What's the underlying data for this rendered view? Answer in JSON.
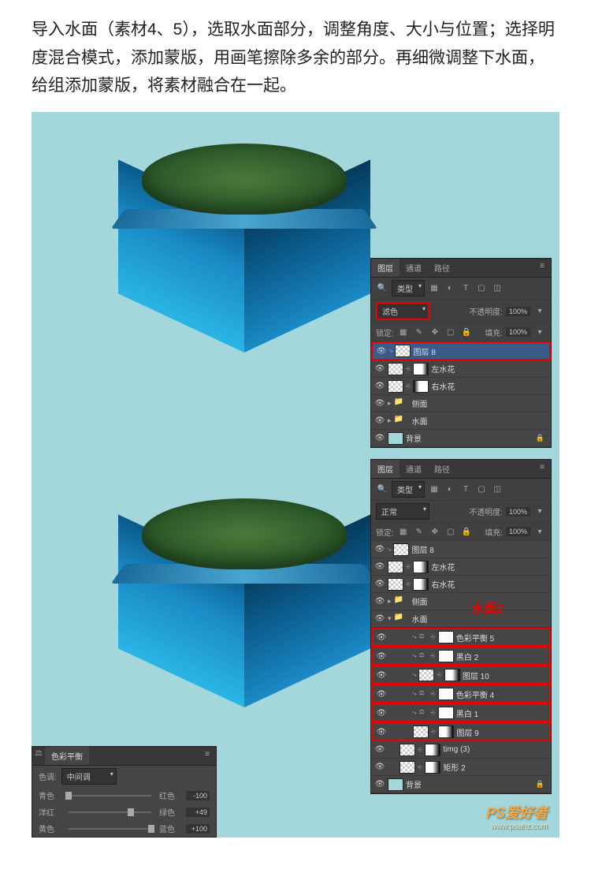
{
  "instructions": "导入水面（素材4、5），选取水面部分，调整角度、大小与位置；选择明度混合模式，添加蒙版，用画笔擦除多余的部分。再细微调整下水面，给组添加蒙版，将素材融合在一起。",
  "panel1": {
    "tabs": [
      "图层",
      "通道",
      "路径"
    ],
    "kind_label": "类型",
    "blend_mode": "滤色",
    "opacity_label": "不透明度:",
    "opacity_value": "100%",
    "lock_label": "锁定:",
    "fill_label": "填充:",
    "fill_value": "100%",
    "layers": [
      {
        "name": "图层 8",
        "selected": true,
        "clip": true
      },
      {
        "name": "左水花"
      },
      {
        "name": "右水花"
      },
      {
        "name": "侧面",
        "folder": true
      },
      {
        "name": "水面",
        "folder": true
      },
      {
        "name": "背景",
        "bg": true,
        "locked": true
      }
    ]
  },
  "panel2": {
    "tabs": [
      "图层",
      "通道",
      "路径"
    ],
    "kind_label": "类型",
    "blend_mode": "正常",
    "opacity_label": "不透明度:",
    "opacity_value": "100%",
    "lock_label": "锁定:",
    "fill_label": "填充:",
    "fill_value": "100%",
    "annotation": "水面2",
    "layers": [
      {
        "name": "图层 8",
        "clip": true
      },
      {
        "name": "左水花"
      },
      {
        "name": "右水花"
      },
      {
        "name": "侧面",
        "folder": true
      },
      {
        "name": "水面",
        "folder": true,
        "open": true
      },
      {
        "name": "色彩平衡 5",
        "indent": 2,
        "adj": true,
        "clip": true,
        "red": true
      },
      {
        "name": "黑白 2",
        "indent": 2,
        "adj": true,
        "clip": true,
        "red": true
      },
      {
        "name": "图层 10",
        "indent": 2,
        "clip": true,
        "red": true
      },
      {
        "name": "色彩平衡 4",
        "indent": 2,
        "adj": true,
        "clip": true,
        "red": true
      },
      {
        "name": "黑白 1",
        "indent": 2,
        "adj": true,
        "clip": true,
        "red": true
      },
      {
        "name": "图层 9",
        "indent": 2,
        "red": true
      },
      {
        "name": "timg (3)",
        "indent": 1,
        "linked": true
      },
      {
        "name": "矩形 2",
        "indent": 1
      },
      {
        "name": "背景",
        "bg": true,
        "locked": true
      }
    ]
  },
  "color_balance": {
    "title": "色彩平衡",
    "tone_label": "色调:",
    "tone_value": "中间调",
    "rows": [
      {
        "left": "青色",
        "right": "红色",
        "value": "-100",
        "pos": 0
      },
      {
        "left": "洋红",
        "right": "绿色",
        "value": "+49",
        "pos": 75
      },
      {
        "left": "黄色",
        "right": "蓝色",
        "value": "+100",
        "pos": 100
      }
    ]
  },
  "watermark": {
    "line1": "PS爱好者",
    "line2": "www.psahz.com"
  }
}
